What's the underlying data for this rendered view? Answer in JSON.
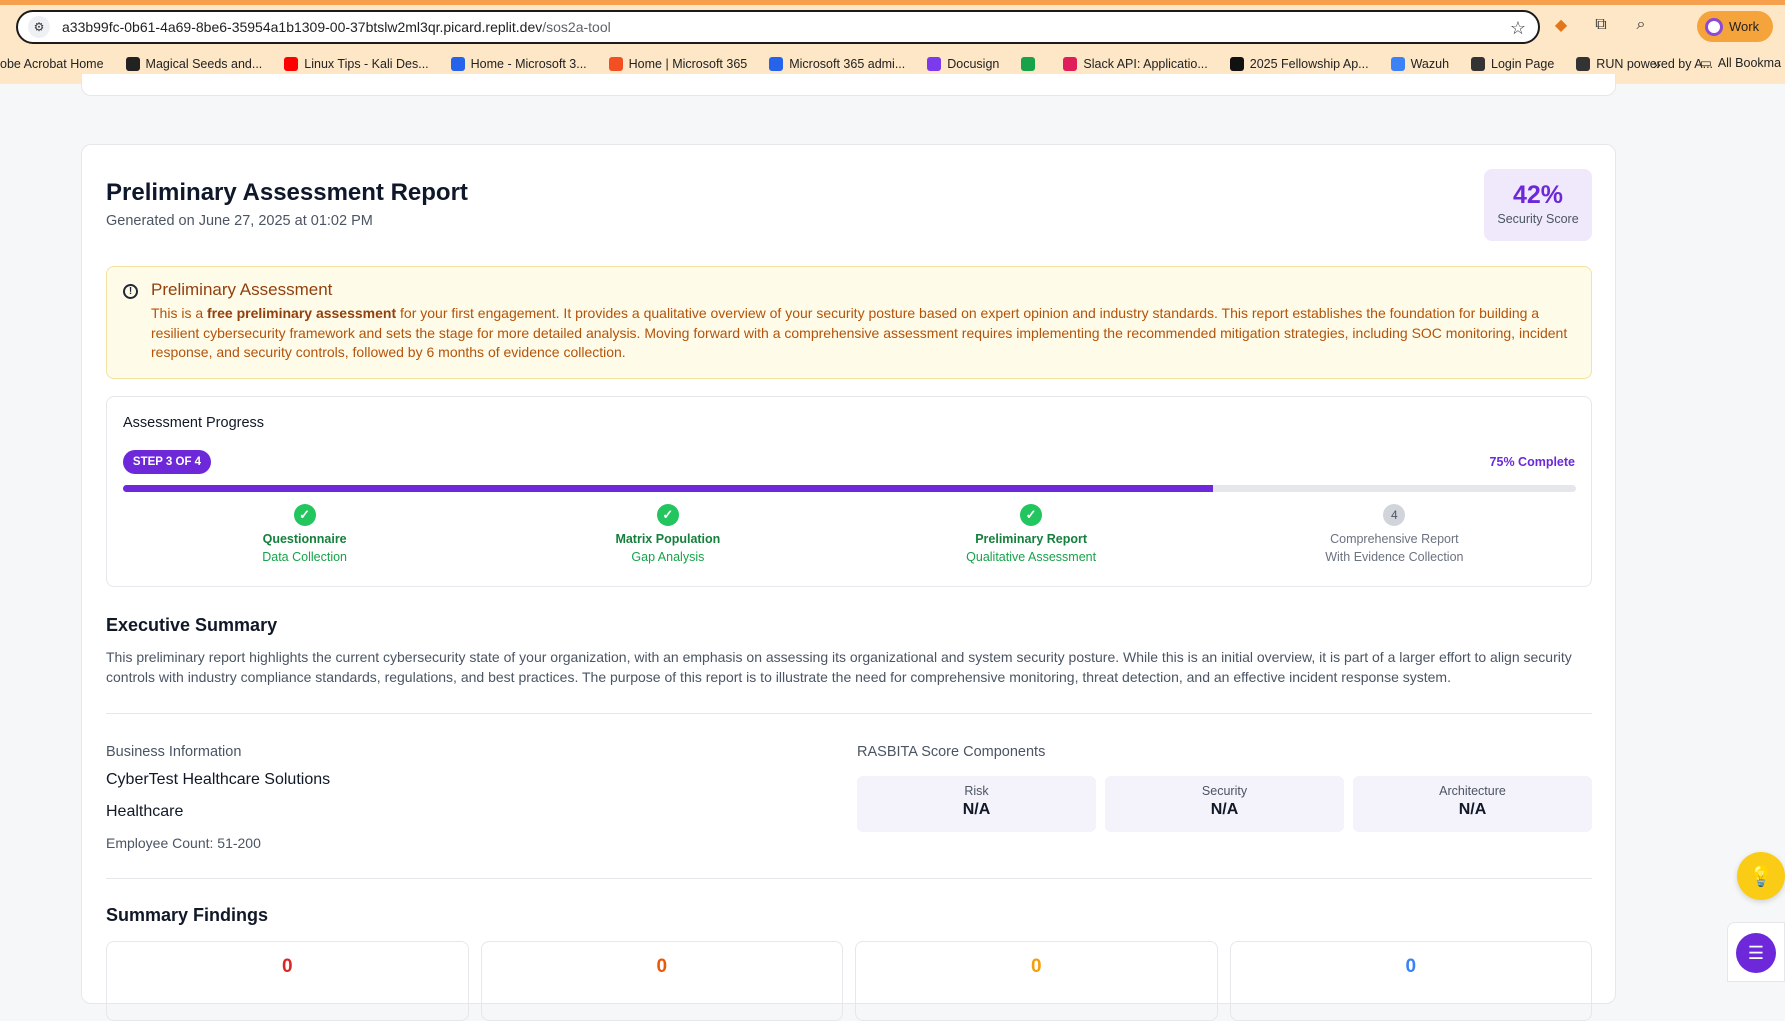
{
  "browser": {
    "url_host": "a33b99fc-0b61-4a69-8be6-35954a1b1309-00-37btslw2ml3qr.picard.replit.dev",
    "url_path": "/sos2a-tool",
    "profile_label": "Work",
    "bookmarks": [
      {
        "label": "obe Acrobat Home",
        "icon": "acrobat-icon",
        "color": "#d32f2f"
      },
      {
        "label": "Magical Seeds and...",
        "icon": "seeds-icon",
        "color": "#222222"
      },
      {
        "label": "Linux Tips - Kali Des...",
        "icon": "youtube-icon",
        "color": "#ff0000"
      },
      {
        "label": "Home - Microsoft 3...",
        "icon": "azure-icon",
        "color": "#2563eb"
      },
      {
        "label": "Home | Microsoft 365",
        "icon": "microsoft-icon",
        "color": "#f25022"
      },
      {
        "label": "Microsoft 365 admi...",
        "icon": "admin-icon",
        "color": "#2563eb"
      },
      {
        "label": "Docusign",
        "icon": "docusign-icon",
        "color": "#7c3aed"
      },
      {
        "label": "",
        "icon": "meet-icon",
        "color": "#16a34a"
      },
      {
        "label": "Slack API: Applicatio...",
        "icon": "slack-icon",
        "color": "#e01e5a"
      },
      {
        "label": "2025 Fellowship Ap...",
        "icon": "fellowship-icon",
        "color": "#111111"
      },
      {
        "label": "Wazuh",
        "icon": "wazuh-icon",
        "color": "#3b82f6"
      },
      {
        "label": "Login Page",
        "icon": "globe-icon",
        "color": "#333333"
      },
      {
        "label": "RUN powered by A...",
        "icon": "globe-icon",
        "color": "#333333"
      }
    ],
    "more_label": "»",
    "all_bookmarks_label": "All Bookma"
  },
  "report": {
    "title": "Preliminary Assessment Report",
    "generated": "Generated on June 27, 2025 at 01:02 PM",
    "score_value": "42%",
    "score_label": "Security Score",
    "notice_title": "Preliminary Assessment",
    "notice_prefix": "This is a ",
    "notice_bold": "free preliminary assessment",
    "notice_suffix": " for your first engagement. It provides a qualitative overview of your security posture based on expert opinion and industry standards. This report establishes the foundation for building a resilient cybersecurity framework and sets the stage for more detailed analysis. Moving forward with a comprehensive assessment requires implementing the recommended mitigation strategies, including SOC monitoring, incident response, and security controls, followed by 6 months of evidence collection."
  },
  "progress": {
    "title": "Assessment Progress",
    "step_label": "STEP 3 OF 4",
    "complete_label": "75% Complete",
    "fraction": 0.75,
    "steps": [
      {
        "marker": "✓",
        "name": "Questionnaire",
        "desc": "Data Collection",
        "done": true
      },
      {
        "marker": "✓",
        "name": "Matrix Population",
        "desc": "Gap Analysis",
        "done": true
      },
      {
        "marker": "✓",
        "name": "Preliminary Report",
        "desc": "Qualitative Assessment",
        "done": true
      },
      {
        "marker": "4",
        "name": "Comprehensive Report",
        "desc": "With Evidence Collection",
        "done": false
      }
    ]
  },
  "executive": {
    "title": "Executive Summary",
    "text": "This preliminary report highlights the current cybersecurity state of your organization, with an emphasis on assessing its organizational and system security posture. While this is an initial overview, it is part of a larger effort to align security controls with industry compliance standards, regulations, and best practices. The purpose of this report is to illustrate the need for comprehensive monitoring, threat detection, and an effective incident response system."
  },
  "business": {
    "title": "Business Information",
    "name": "CyberTest Healthcare Solutions",
    "industry": "Healthcare",
    "employees": "Employee Count: 51-200"
  },
  "rasbita": {
    "title": "RASBITA Score Components",
    "components": [
      {
        "label": "Risk",
        "value": "N/A"
      },
      {
        "label": "Security",
        "value": "N/A"
      },
      {
        "label": "Architecture",
        "value": "N/A"
      }
    ]
  },
  "findings": {
    "title": "Summary Findings",
    "items": [
      {
        "value": "0",
        "color": "#dc2626"
      },
      {
        "value": "0",
        "color": "#ea580c"
      },
      {
        "value": "0",
        "color": "#f59e0b"
      },
      {
        "value": "0",
        "color": "#3b82f6"
      }
    ]
  }
}
